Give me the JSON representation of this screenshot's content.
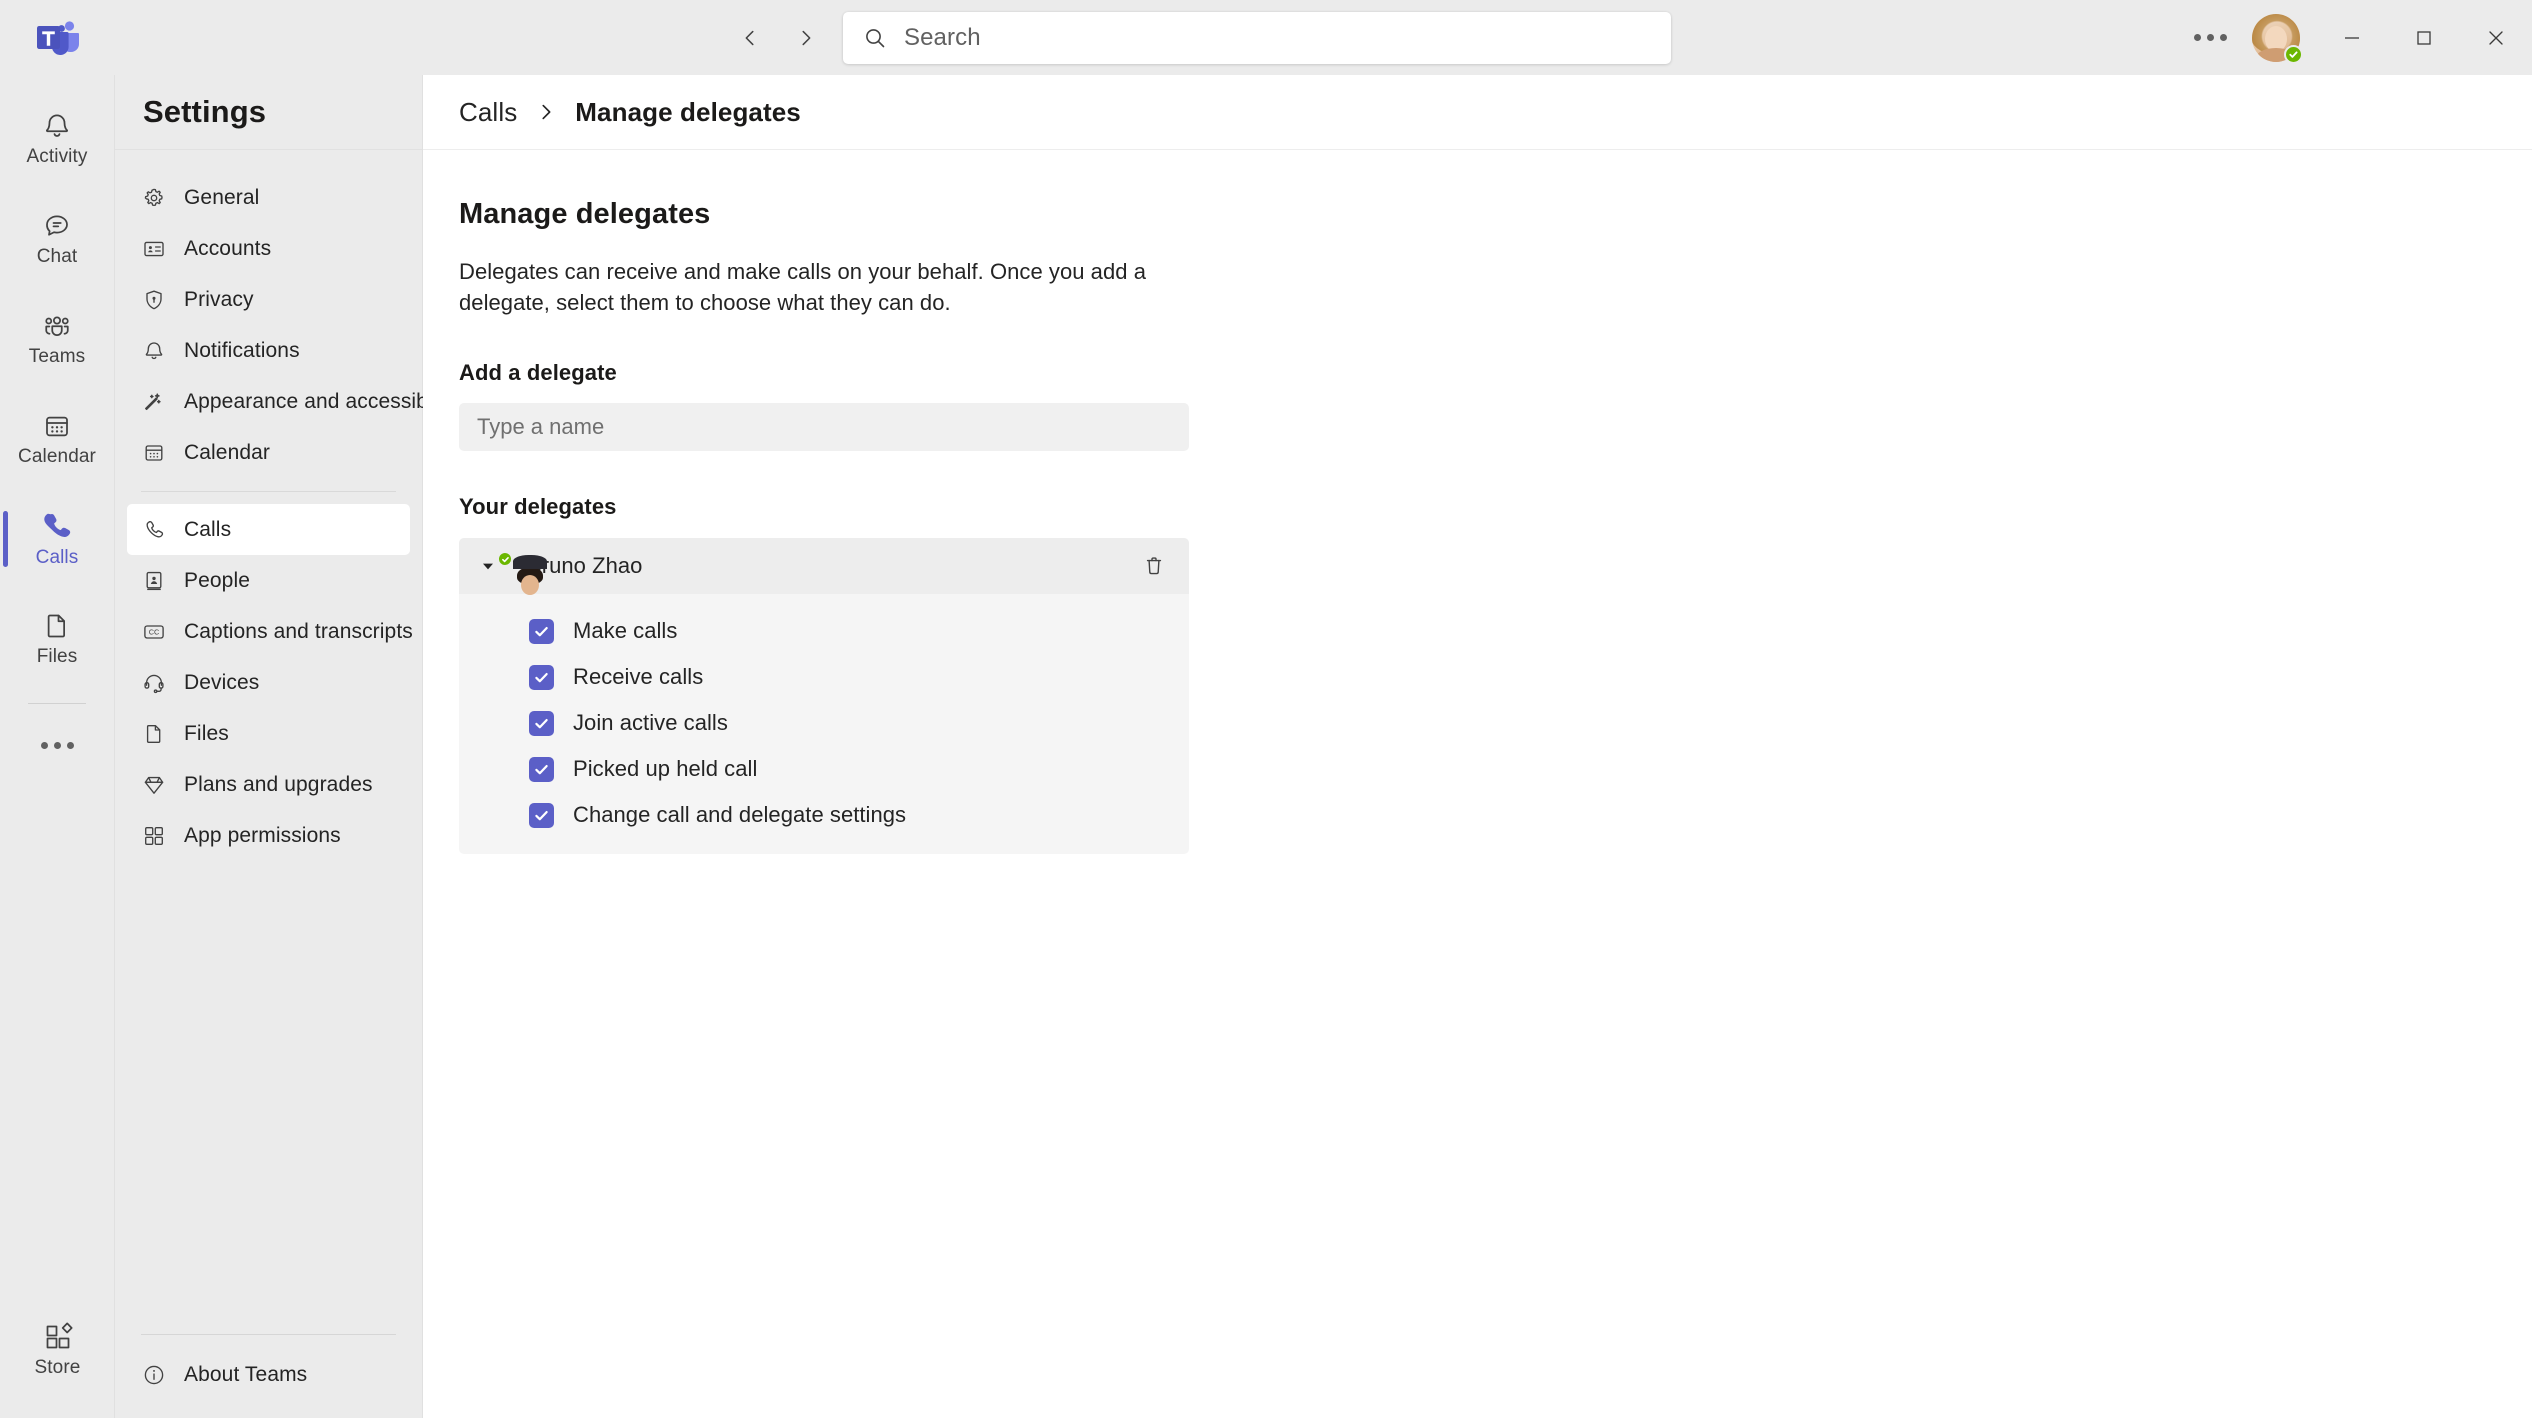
{
  "titlebar": {
    "back_label": "Back",
    "forward_label": "Forward",
    "search_placeholder": "Search",
    "more_label": "Settings and more",
    "account_name": "Account manager",
    "minimize_label": "Minimize",
    "maximize_label": "Maximize",
    "close_label": "Close"
  },
  "rail": {
    "logo_label": "Microsoft Teams",
    "items": [
      {
        "label": "Activity",
        "icon": "bell-icon",
        "active": false
      },
      {
        "label": "Chat",
        "icon": "chat-icon",
        "active": false
      },
      {
        "label": "Teams",
        "icon": "teams-icon",
        "active": false
      },
      {
        "label": "Calendar",
        "icon": "calendar-icon",
        "active": false
      },
      {
        "label": "Calls",
        "icon": "phone-icon",
        "active": true
      },
      {
        "label": "Files",
        "icon": "file-icon",
        "active": false
      }
    ],
    "more_label": "More apps",
    "bottom": {
      "label": "Store",
      "icon": "store-icon"
    }
  },
  "settings": {
    "title": "Settings",
    "items": [
      {
        "label": "General",
        "icon": "gear-icon",
        "active": false
      },
      {
        "label": "Accounts",
        "icon": "id-card-icon",
        "active": false
      },
      {
        "label": "Privacy",
        "icon": "shield-lock-icon",
        "active": false
      },
      {
        "label": "Notifications",
        "icon": "bell-icon",
        "active": false
      },
      {
        "label": "Appearance and accessibility",
        "icon": "wand-icon",
        "active": false
      },
      {
        "label": "Calendar",
        "icon": "calendar-icon",
        "active": false
      }
    ],
    "items_after_divider": [
      {
        "label": "Calls",
        "icon": "phone-icon",
        "active": true
      },
      {
        "label": "People",
        "icon": "contacts-book-icon",
        "active": false
      },
      {
        "label": "Captions and transcripts",
        "icon": "closed-caption-icon",
        "active": false
      },
      {
        "label": "Devices",
        "icon": "headset-icon",
        "active": false
      },
      {
        "label": "Files",
        "icon": "file-icon",
        "active": false
      },
      {
        "label": "Plans and upgrades",
        "icon": "diamond-icon",
        "active": false
      },
      {
        "label": "App permissions",
        "icon": "apps-icon",
        "active": false
      }
    ],
    "about": {
      "label": "About Teams",
      "icon": "info-icon"
    }
  },
  "breadcrumb": {
    "parent": "Calls",
    "separator": "chevron-right-icon",
    "current": "Manage delegates"
  },
  "main": {
    "title": "Manage delegates",
    "description": "Delegates can receive and make calls on your behalf. Once you add a delegate, select them to choose what they can do.",
    "add_section_label": "Add a delegate",
    "add_input_placeholder": "Type a name",
    "add_input_value": "",
    "delegates_section_label": "Your delegates",
    "delegates": [
      {
        "name": "Bruno Zhao",
        "presence": "available",
        "expanded": true,
        "delete_label": "Remove delegate",
        "permissions": [
          {
            "label": "Make calls",
            "checked": true
          },
          {
            "label": "Receive calls",
            "checked": true
          },
          {
            "label": "Join active calls",
            "checked": true
          },
          {
            "label": "Picked up held call",
            "checked": true
          },
          {
            "label": "Change call and delegate settings",
            "checked": true
          }
        ]
      }
    ]
  },
  "colors": {
    "accent": "#5b5fc7",
    "presence_available": "#6bb700",
    "app_bg": "#ebebeb",
    "content_bg": "#ffffff",
    "card_bg": "#f5f5f5"
  }
}
